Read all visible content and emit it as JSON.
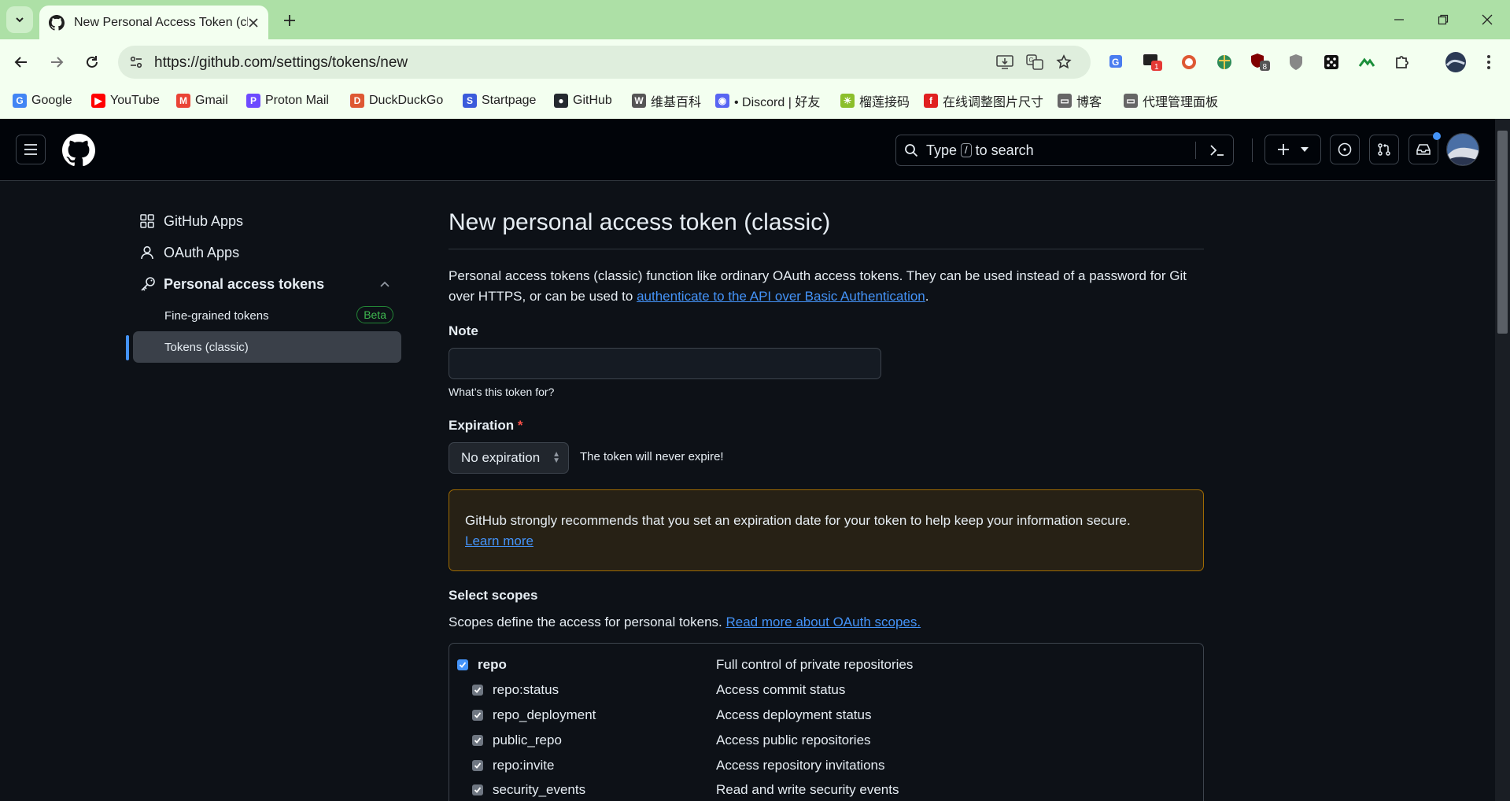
{
  "browser": {
    "tab_title": "New Personal Access Token (classic)",
    "url": "https://github.com/settings/tokens/new",
    "extensions": [
      {
        "name": "translate-ext-icon",
        "color": "#4a7df0"
      },
      {
        "name": "mail-ext-icon",
        "badge": "1"
      },
      {
        "name": "duckduckgo-ext-icon",
        "color": "#de5833"
      },
      {
        "name": "globe-ext-icon",
        "color": "#2e8b57"
      },
      {
        "name": "ublock-ext-icon",
        "badge": "8"
      },
      {
        "name": "shield-ext-icon",
        "color": "#888"
      },
      {
        "name": "dice-ext-icon",
        "color": "#111"
      },
      {
        "name": "tampermonkey-ext-icon",
        "color": "#1a8f3a"
      },
      {
        "name": "puzzle-ext-icon",
        "color": "#333"
      }
    ],
    "bookmarks": [
      {
        "label": "Google",
        "icon": "G",
        "color": "#4285f4"
      },
      {
        "label": "YouTube",
        "icon": "▶",
        "color": "#ff0000"
      },
      {
        "label": "Gmail",
        "icon": "M",
        "color": "#ea4335"
      },
      {
        "label": "Proton Mail",
        "icon": "P",
        "color": "#6d4aff"
      },
      {
        "label": "DuckDuckGo",
        "icon": "D",
        "color": "#de5833"
      },
      {
        "label": "Startpage",
        "icon": "S",
        "color": "#3b5bdb"
      },
      {
        "label": "GitHub",
        "icon": "●",
        "color": "#24292f"
      },
      {
        "label": "维基百科",
        "icon": "W",
        "color": "#555555"
      },
      {
        "label": "• Discord | 好友",
        "icon": "◉",
        "color": "#5865f2"
      },
      {
        "label": "榴莲接码",
        "icon": "☀",
        "color": "#8bbf2b"
      },
      {
        "label": "在线调整图片尺寸",
        "icon": "f",
        "color": "#e02020"
      },
      {
        "label": "博客",
        "icon": "▭",
        "color": "#666666"
      },
      {
        "label": "代理管理面板",
        "icon": "▭",
        "color": "#666666"
      }
    ]
  },
  "header": {
    "search_prefix": "Type",
    "search_key": "/",
    "search_suffix": "to search"
  },
  "sidebar": {
    "items": [
      {
        "label": "GitHub Apps"
      },
      {
        "label": "OAuth Apps"
      },
      {
        "label": "Personal access tokens"
      }
    ],
    "sub_items": [
      {
        "label": "Fine-grained tokens",
        "badge": "Beta"
      },
      {
        "label": "Tokens (classic)"
      }
    ]
  },
  "main": {
    "title": "New personal access token (classic)",
    "intro_text": "Personal access tokens (classic) function like ordinary OAuth access tokens. They can be used instead of a password for Git over HTTPS, or can be used to",
    "intro_link": "authenticate to the API over Basic Authentication",
    "intro_end": ".",
    "note_label": "Note",
    "note_value": "",
    "note_hint": "What’s this token for?",
    "expiration_label": "Expiration",
    "expiration_required": "*",
    "expiration_value": "No expiration",
    "expiration_text": "The token will never expire!",
    "warning_text": "GitHub strongly recommends that you set an expiration date for your token to help keep your information secure.",
    "warning_link": "Learn more",
    "scopes_label": "Select scopes",
    "scopes_desc": "Scopes define the access for personal tokens.",
    "scopes_link": "Read more about OAuth scopes.",
    "scopes": [
      {
        "name": "repo",
        "desc": "Full control of private repositories",
        "checked": true,
        "child": false
      },
      {
        "name": "repo:status",
        "desc": "Access commit status",
        "checked": true,
        "child": true
      },
      {
        "name": "repo_deployment",
        "desc": "Access deployment status",
        "checked": true,
        "child": true
      },
      {
        "name": "public_repo",
        "desc": "Access public repositories",
        "checked": true,
        "child": true
      },
      {
        "name": "repo:invite",
        "desc": "Access repository invitations",
        "checked": true,
        "child": true
      },
      {
        "name": "security_events",
        "desc": "Read and write security events",
        "checked": true,
        "child": true
      }
    ]
  }
}
